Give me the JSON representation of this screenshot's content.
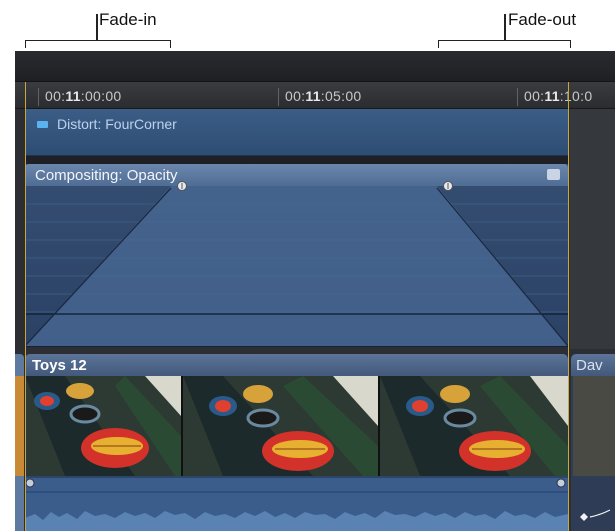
{
  "annotations": {
    "fade_in": "Fade-in",
    "fade_out": "Fade-out"
  },
  "ruler": {
    "timecodes": [
      {
        "prefix": "00:",
        "bold": "11",
        "suffix": ":00:00"
      },
      {
        "prefix": "00:",
        "bold": "11",
        "suffix": ":05:00"
      },
      {
        "prefix": "00:",
        "bold": "11",
        "suffix": ":10:0"
      }
    ]
  },
  "effects": {
    "distort_label": "Distort: FourCorner",
    "opacity_label": "Compositing: Opacity"
  },
  "clips": {
    "main_name": "Toys 12",
    "next_name": "Dav"
  },
  "colors": {
    "accent_edge": "#c8a83a",
    "effect_blue": "#3b5d86",
    "opacity_header": "#6b87ad",
    "audio_blue": "#3f6391"
  }
}
